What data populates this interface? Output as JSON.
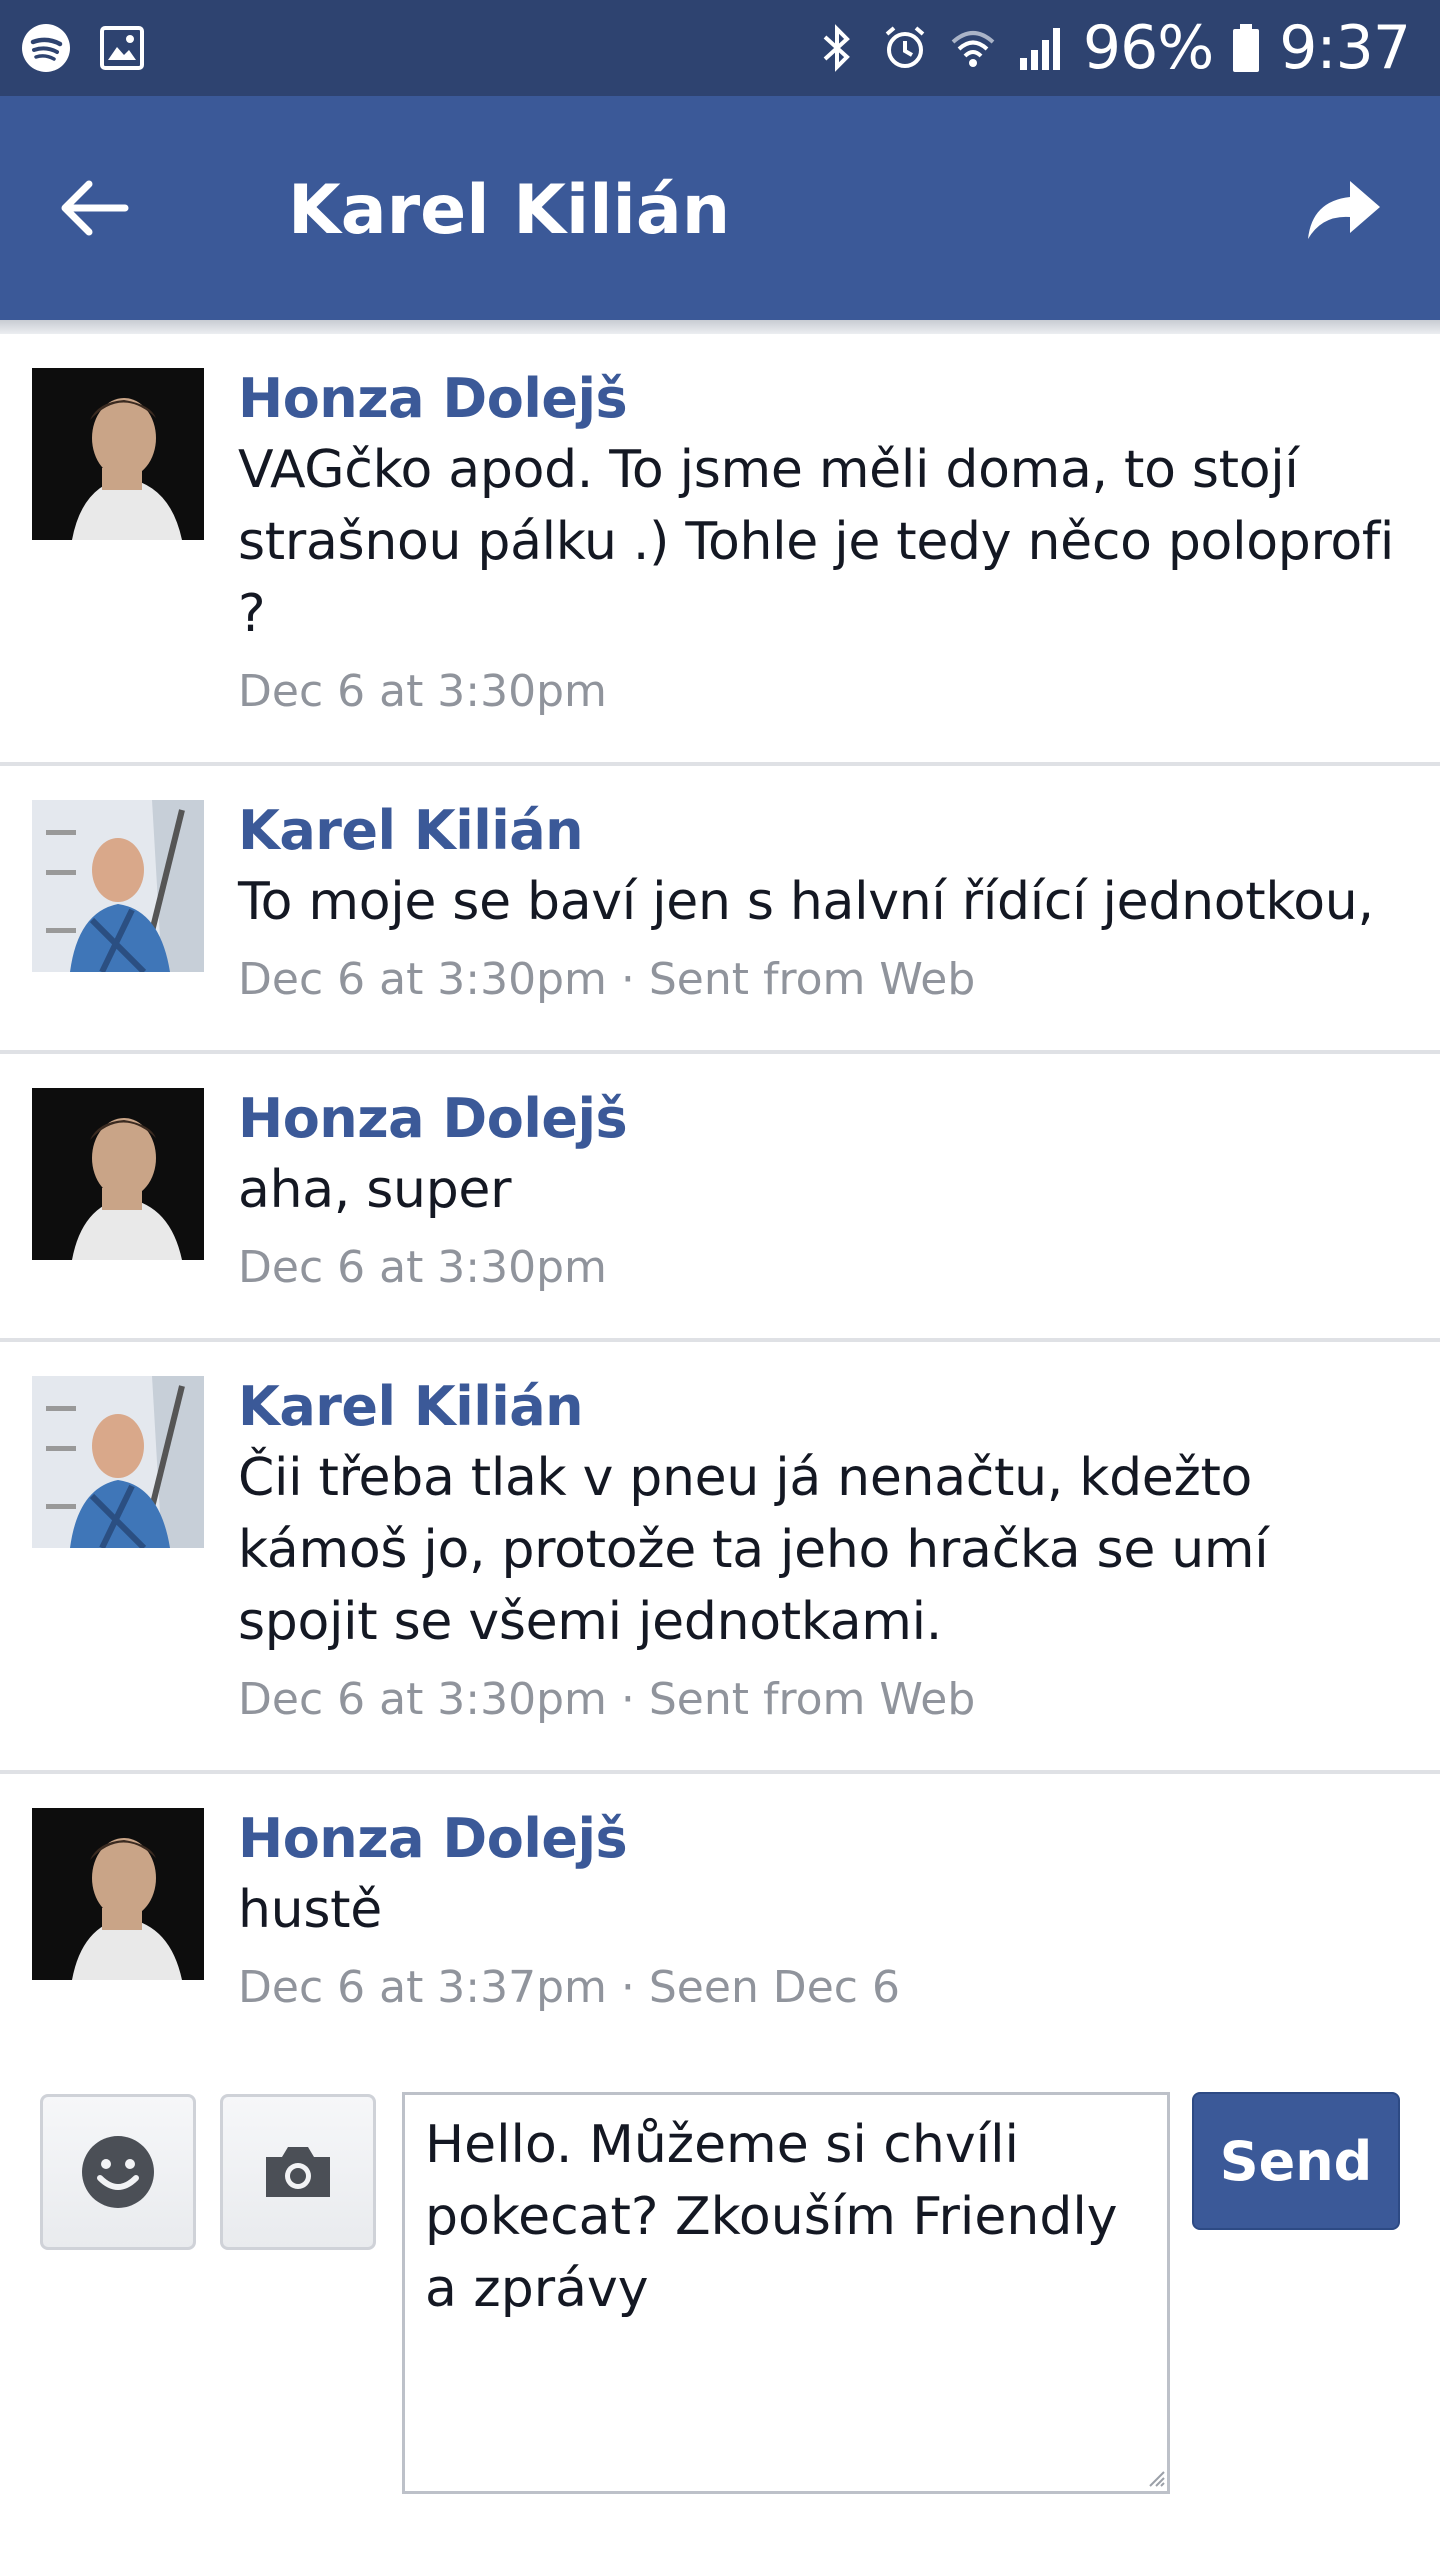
{
  "status_bar": {
    "battery": "96%",
    "time": "9:37",
    "icons": [
      "spotify-icon",
      "gallery-icon",
      "bluetooth-icon",
      "alarm-icon",
      "wifi-icon",
      "signal-icon",
      "battery-icon"
    ]
  },
  "header": {
    "title": "Karel Kilián",
    "back_icon": "arrow-left-icon",
    "share_icon": "share-arrow-icon"
  },
  "messages": [
    {
      "sender": "Honza Dolejš",
      "avatar": "avatar-honza",
      "text": "VAGčko apod. To jsme měli doma, to stojí strašnou pálku .) Tohle je tedy něco poloprofi ?",
      "meta": "Dec 6 at 3:30pm"
    },
    {
      "sender": "Karel Kilián",
      "avatar": "avatar-karel",
      "text": "To moje se baví jen s halvní řídící jednotkou,",
      "meta": "Dec 6 at 3:30pm · Sent from Web"
    },
    {
      "sender": "Honza Dolejš",
      "avatar": "avatar-honza",
      "text": "aha, super",
      "meta": "Dec 6 at 3:30pm"
    },
    {
      "sender": "Karel Kilián",
      "avatar": "avatar-karel",
      "text": "Čii třeba tlak v pneu já nenačtu, kdežto kámoš jo, protože ta jeho hračka se umí spojit se všemi jednotkami.",
      "meta": "Dec 6 at 3:30pm · Sent from Web"
    },
    {
      "sender": "Honza Dolejš",
      "avatar": "avatar-honza",
      "text": "hustě",
      "meta": "Dec 6 at 3:37pm · Seen Dec 6"
    }
  ],
  "composer": {
    "input_value": "Hello. Můžeme si chvíli pokecat? Zkouším Friendly a zprávy",
    "send_label": "Send",
    "emoji_icon": "smiley-icon",
    "camera_icon": "camera-icon"
  },
  "colors": {
    "status_bar": "#2e4370",
    "header": "#3b5998",
    "sender": "#3b5998",
    "meta": "#90949c"
  }
}
